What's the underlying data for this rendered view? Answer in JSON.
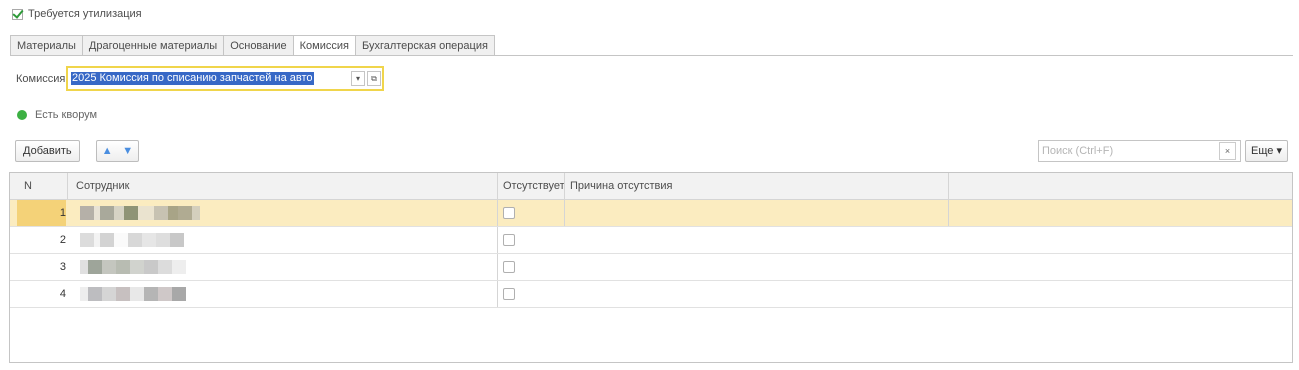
{
  "recycling": {
    "label": "Требуется утилизация",
    "checked": true
  },
  "tabs": [
    {
      "label": "Материалы",
      "active": false
    },
    {
      "label": "Драгоценные материалы",
      "active": false
    },
    {
      "label": "Основание",
      "active": false
    },
    {
      "label": "Комиссия",
      "active": true
    },
    {
      "label": "Бухгалтерская операция",
      "active": false
    }
  ],
  "commission": {
    "label": "Комиссия:",
    "value": "2025 Комиссия по списанию запчастей на авто",
    "dropdown_icon": "chevron-down-icon",
    "open_icon": "open-icon"
  },
  "quorum": {
    "label": "Есть кворум",
    "status_color": "#3cb043"
  },
  "toolbar": {
    "add_label": "Добавить",
    "move_up_icon": "arrow-up-icon",
    "move_down_icon": "arrow-down-icon",
    "search_placeholder": "Поиск (Ctrl+F)",
    "clear_icon": "×",
    "more_label": "Еще ▾"
  },
  "table": {
    "columns": [
      "N",
      "Сотрудник",
      "Отсутствует",
      "Причина отсутствия"
    ],
    "rows": [
      {
        "n": "1",
        "employee": "",
        "absent": false,
        "reason": "",
        "selected": true
      },
      {
        "n": "2",
        "employee": "",
        "absent": false,
        "reason": "",
        "selected": false
      },
      {
        "n": "3",
        "employee": "",
        "absent": false,
        "reason": "",
        "selected": false
      },
      {
        "n": "4",
        "employee": "",
        "absent": false,
        "reason": "",
        "selected": false
      }
    ]
  },
  "colors": {
    "selection_row": "#fbecc0",
    "selection_field": "#f0d54b",
    "highlight": "#3768c6"
  }
}
